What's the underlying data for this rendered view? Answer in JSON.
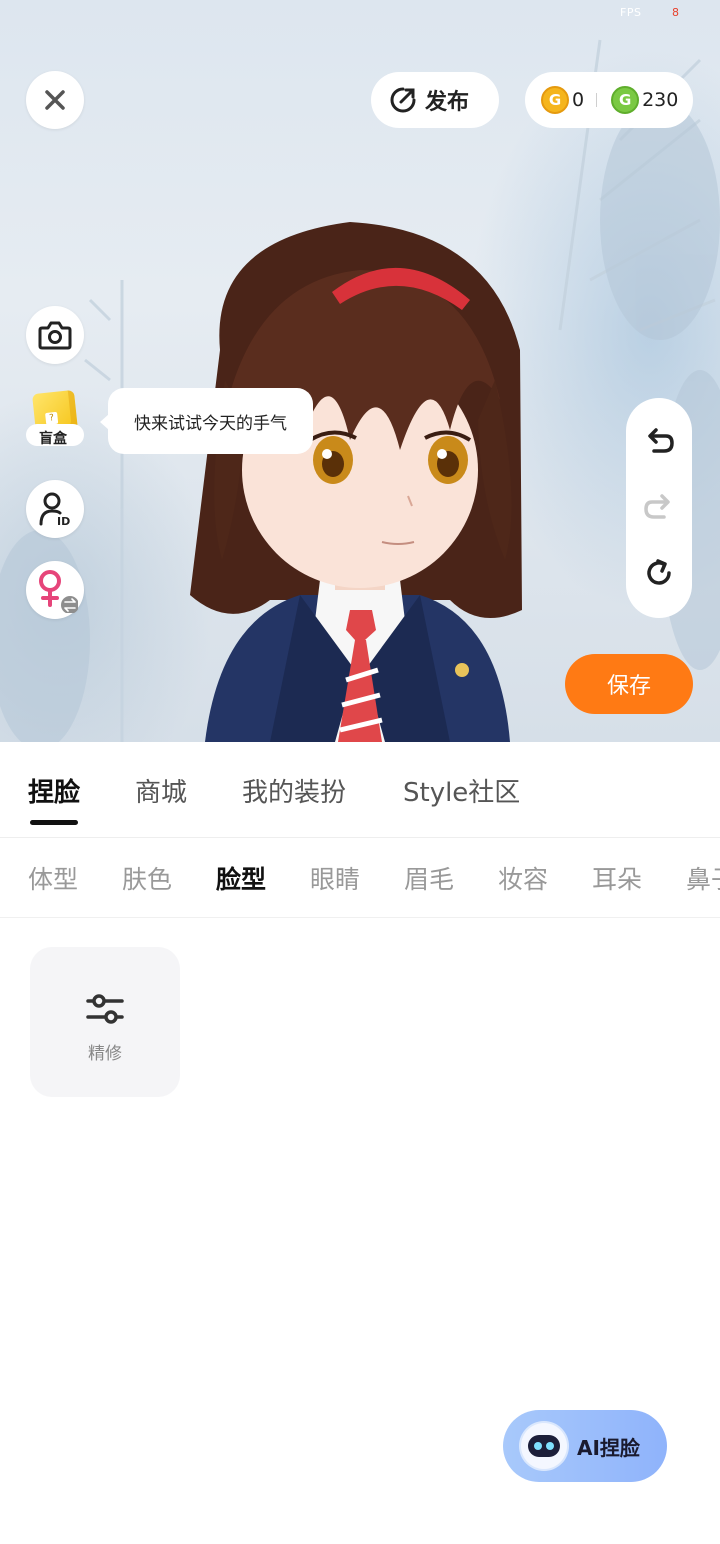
{
  "status": {
    "fps_label": "FPS",
    "fps_value": "8"
  },
  "top_bar": {
    "close_icon": "close-icon",
    "publish_label": "发布",
    "currency": [
      {
        "icon": "gold-coin-icon",
        "value": "0",
        "color": "#f5b51d"
      },
      {
        "icon": "green-coin-icon",
        "value": "230",
        "color": "#7ac943"
      }
    ]
  },
  "left_tools": {
    "camera_icon": "camera-icon",
    "blind_box_label": "盲盒",
    "tip_bubble": "快来试试今天的手气",
    "avatar_id_icon": "avatar-id-icon",
    "gender_icon": "female-swap-icon"
  },
  "history": {
    "undo": "undo-icon",
    "redo": "redo-icon",
    "reset": "reset-icon"
  },
  "save_label": "保存",
  "main_tabs": [
    {
      "label": "捏脸",
      "active": true
    },
    {
      "label": "商城",
      "active": false
    },
    {
      "label": "我的装扮",
      "active": false
    },
    {
      "label": "Style社区",
      "active": false
    }
  ],
  "sub_tabs": [
    {
      "label": "体型",
      "active": false
    },
    {
      "label": "肤色",
      "active": false
    },
    {
      "label": "脸型",
      "active": true
    },
    {
      "label": "眼睛",
      "active": false
    },
    {
      "label": "眉毛",
      "active": false
    },
    {
      "label": "妆容",
      "active": false
    },
    {
      "label": "耳朵",
      "active": false
    },
    {
      "label": "鼻子",
      "active": false
    }
  ],
  "options": [
    {
      "label": "精修",
      "icon": "sliders-icon"
    }
  ],
  "ai_button": {
    "label": "AI捏脸",
    "icon": "robot-icon"
  },
  "colors": {
    "accent": "#ff7a14",
    "ai_gradient": "#8fb3fb",
    "text_active": "#111111",
    "text_inactive": "#999999"
  }
}
